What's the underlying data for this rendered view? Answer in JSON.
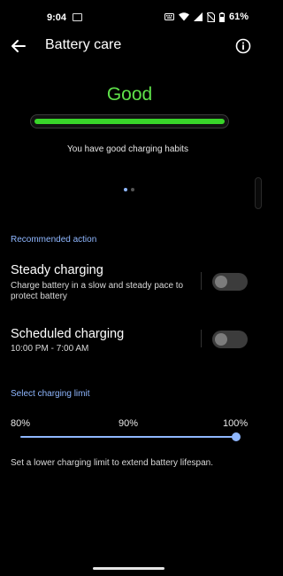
{
  "status_bar": {
    "time": "9:04",
    "battery_percent": "61%",
    "icons": [
      "gallery-notification-icon",
      "keyboard-icon",
      "wifi-icon",
      "signal-icon",
      "no-sim-icon",
      "battery-icon"
    ]
  },
  "app_bar": {
    "title": "Battery care",
    "back_icon": "arrow-left-icon",
    "info_icon": "info-icon"
  },
  "status_card": {
    "status": "Good",
    "status_color": "#5fe24a",
    "bar_fill_fraction": 1.0,
    "bar_color": "#39d42a",
    "message": "You have good charging habits",
    "page_count": 2,
    "active_page": 0
  },
  "recommended": {
    "header": "Recommended action",
    "items": [
      {
        "title": "Steady charging",
        "subtitle": "Charge battery in a slow and steady pace to protect battery",
        "enabled": false
      },
      {
        "title": "Scheduled charging",
        "subtitle": "10:00 PM - 7:00 AM",
        "enabled": false
      }
    ]
  },
  "charging_limit": {
    "header": "Select charging limit",
    "options": [
      "80%",
      "90%",
      "100%"
    ],
    "selected": "100%",
    "selected_fraction": 1.0,
    "note": "Set a lower charging limit to extend battery lifespan."
  },
  "colors": {
    "accent": "#8fb7ff",
    "background": "#000000"
  }
}
